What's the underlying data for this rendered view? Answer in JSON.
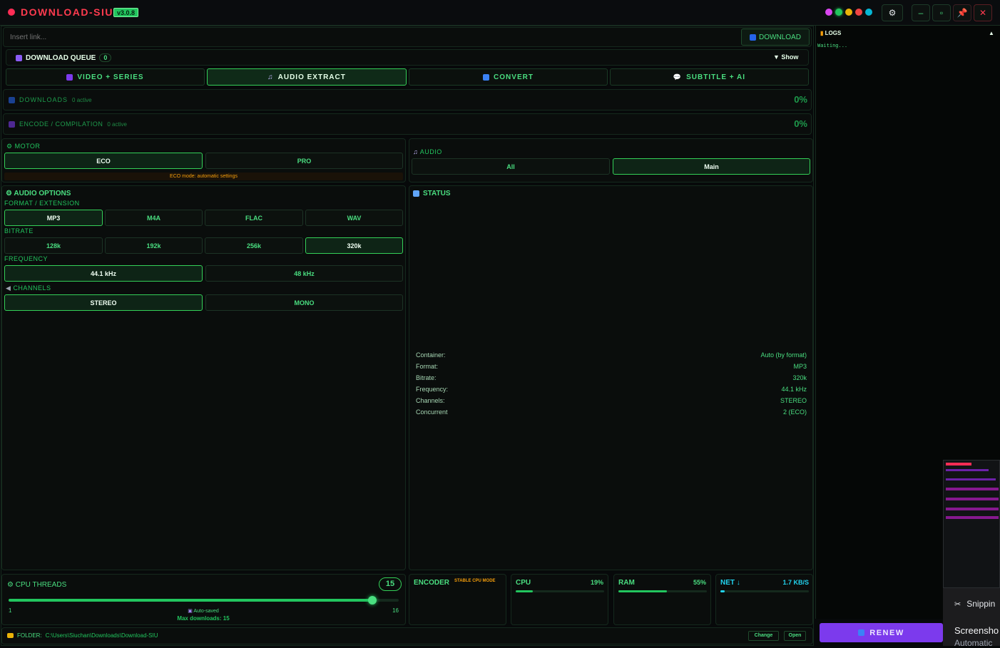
{
  "app": {
    "title": "DOWNLOAD-SIU",
    "version": "v3.0.8"
  },
  "titlebar": {
    "dots": [
      "#d946ef",
      "#22c55e",
      "#eab308",
      "#ef4444",
      "#06b6d4"
    ],
    "settings_icon": "gear-icon",
    "minimize": "–",
    "maximize": "▫",
    "pin_icon": "pin-icon",
    "close": "✕"
  },
  "link": {
    "placeholder": "Insert link...",
    "download_label": "DOWNLOAD"
  },
  "queue": {
    "label": "DOWNLOAD QUEUE",
    "count": "0",
    "show_label": "▼ Show"
  },
  "tabs": [
    {
      "label": "VIDEO + SERIES"
    },
    {
      "label": "AUDIO EXTRACT"
    },
    {
      "label": "CONVERT"
    },
    {
      "label": "SUBTITLE + AI"
    }
  ],
  "active_tab": "AUDIO EXTRACT",
  "downloads": {
    "label": "DOWNLOADS",
    "active": "0 active",
    "percent": "0%"
  },
  "encode": {
    "label": "ENCODE / COMPILATION",
    "active": "0 active",
    "percent": "0%"
  },
  "motor": {
    "label": "MOTOR",
    "options": [
      "ECO",
      "PRO"
    ],
    "selected": "ECO",
    "note": "ECO mode: automatic settings"
  },
  "audio": {
    "label": "AUDIO",
    "options": [
      "All",
      "Main"
    ],
    "selected": "Main"
  },
  "audio_options": {
    "label": "AUDIO OPTIONS",
    "format_label": "FORMAT / EXTENSION",
    "formats": [
      "MP3",
      "M4A",
      "FLAC",
      "WAV"
    ],
    "format_selected": "MP3",
    "bitrate_label": "BITRATE",
    "bitrates": [
      "128k",
      "192k",
      "256k",
      "320k"
    ],
    "bitrate_selected": "320k",
    "frequency_label": "FREQUENCY",
    "frequencies": [
      "44.1 kHz",
      "48 kHz"
    ],
    "frequency_selected": "44.1 kHz",
    "channels_label": "CHANNELS",
    "channels": [
      "STEREO",
      "MONO"
    ],
    "channels_selected": "STEREO"
  },
  "status": {
    "label": "STATUS",
    "rows": [
      {
        "k": "Container:",
        "v": "Auto (by format)"
      },
      {
        "k": "Format:",
        "v": "MP3"
      },
      {
        "k": "Bitrate:",
        "v": "320k"
      },
      {
        "k": "Frequency:",
        "v": "44.1 kHz"
      },
      {
        "k": "Channels:",
        "v": "STEREO"
      },
      {
        "k": "Concurrent",
        "v": "2 (ECO)"
      }
    ]
  },
  "cpu_threads": {
    "label": "CPU THREADS",
    "value": "15",
    "min": "1",
    "max": "16",
    "fraction": 0.933,
    "autosaved": "Auto-saved",
    "max_downloads": "Max downloads: 15"
  },
  "encoder": {
    "label": "ENCODER",
    "mode": "STABLE CPU MODE"
  },
  "cpu": {
    "label": "CPU",
    "value": "19%",
    "fraction": 0.19
  },
  "ram": {
    "label": "RAM",
    "value": "55%",
    "fraction": 0.55
  },
  "net": {
    "label": "NET ↓",
    "value": "1.7 KB/S",
    "fraction": 0.05
  },
  "folder": {
    "label": "FOLDER:",
    "path": "C:\\Users\\Siuchan\\Downloads\\Download-SIU",
    "change": "Change",
    "open": "Open"
  },
  "logs": {
    "label": "LOGS",
    "text": "Waiting...",
    "collapse": "▲"
  },
  "renew": {
    "label": "RENEW"
  },
  "snipping": {
    "app": "Snippin",
    "title": "Screensho",
    "sub": "Automatic"
  },
  "colors": {
    "accent": "#4ade80",
    "brand": "#ff3b4f",
    "renew": "#7c3aed",
    "net": "#22d3ee",
    "warn": "#f59e0b"
  }
}
